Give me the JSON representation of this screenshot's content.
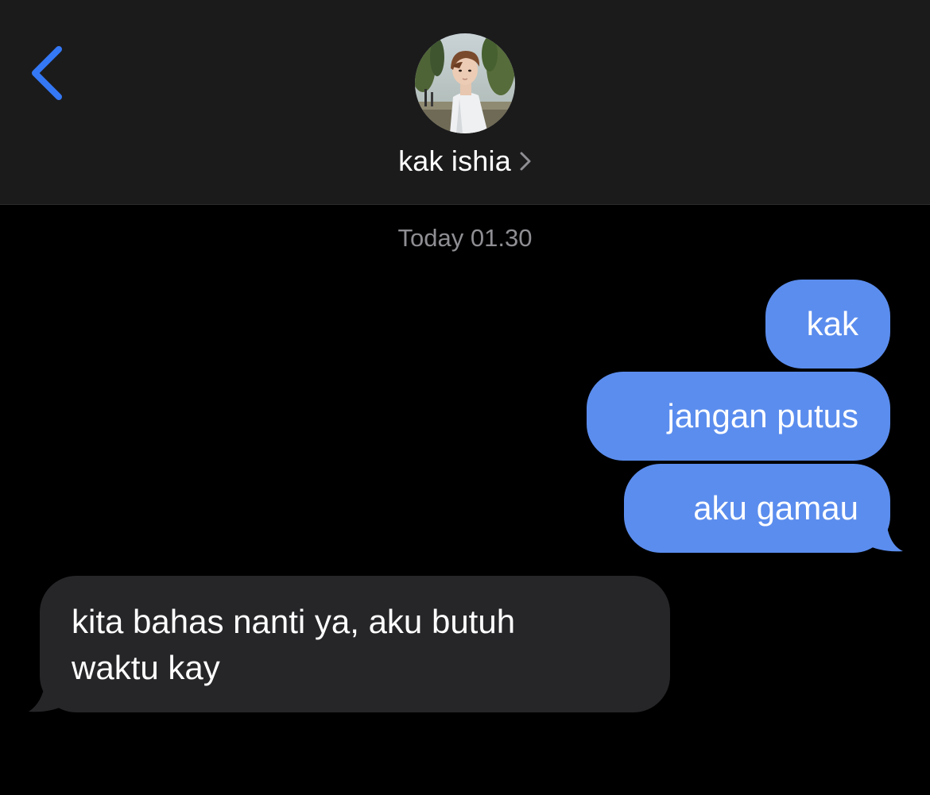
{
  "header": {
    "back_icon": "chevron-left-icon",
    "contact_name": "kak ishia",
    "contact_chevron_icon": "chevron-right-icon",
    "avatar_icon": "contact-avatar-photo"
  },
  "conversation": {
    "timestamp": "Today 01.30",
    "messages": [
      {
        "direction": "sent",
        "text": "kak"
      },
      {
        "direction": "sent",
        "text": "jangan putus"
      },
      {
        "direction": "sent",
        "text": "aku gamau"
      },
      {
        "direction": "received",
        "text_lines": [
          "kita bahas nanti ya, aku butuh",
          "waktu kay"
        ]
      }
    ]
  },
  "colors": {
    "header_background": "#1b1b1c",
    "background": "#000000",
    "sent_bubble": "#5b8dee",
    "received_bubble": "#262629",
    "accent_blue": "#3478f6",
    "timestamp_text": "#8e8e93"
  }
}
